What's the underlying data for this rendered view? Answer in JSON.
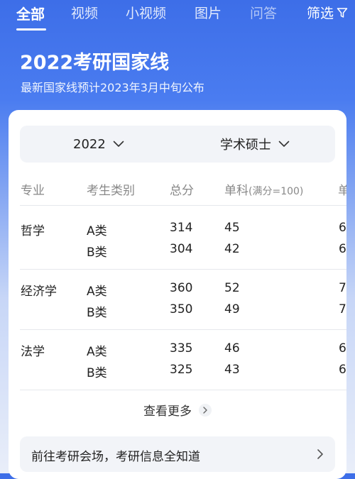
{
  "nav": {
    "tabs": [
      {
        "label": "全部"
      },
      {
        "label": "视频"
      },
      {
        "label": "小视频"
      },
      {
        "label": "图片"
      },
      {
        "label": "问答"
      }
    ],
    "filter_label": "筛选",
    "filter_icon": "funnel-icon"
  },
  "hero": {
    "title": "2022考研国家线",
    "subtitle": "最新国家线预计2023年3月中旬公布"
  },
  "selectors": {
    "year": "2022",
    "degree_type": "学术硕士"
  },
  "table": {
    "headers": {
      "major": "专业",
      "category": "考生类别",
      "total": "总分",
      "single": "单科",
      "single_note": "(满分=100)",
      "single2": "单"
    },
    "rows": [
      {
        "major": "哲学",
        "lines": [
          {
            "category": "A类",
            "total": "314",
            "single": "45",
            "single2": "6"
          },
          {
            "category": "B类",
            "total": "304",
            "single": "42",
            "single2": "6"
          }
        ]
      },
      {
        "major": "经济学",
        "lines": [
          {
            "category": "A类",
            "total": "360",
            "single": "52",
            "single2": "7"
          },
          {
            "category": "B类",
            "total": "350",
            "single": "49",
            "single2": "7"
          }
        ]
      },
      {
        "major": "法学",
        "lines": [
          {
            "category": "A类",
            "total": "335",
            "single": "46",
            "single2": "6"
          },
          {
            "category": "B类",
            "total": "325",
            "single": "43",
            "single2": "6"
          }
        ]
      }
    ]
  },
  "more_label": "查看更多",
  "bottom_link": "前往考研会场，考研信息全知道",
  "colors": {
    "brand_blue": "#3d6ee8",
    "text": "#222222",
    "muted": "#888888"
  }
}
